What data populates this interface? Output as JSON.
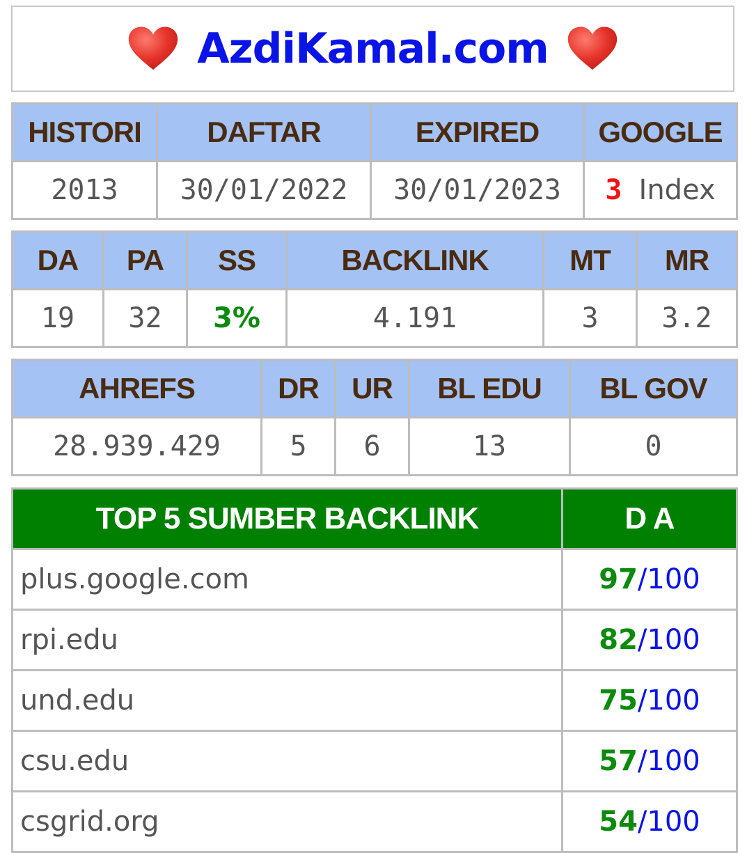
{
  "title": "AzdiKamal.com",
  "colors": {
    "title": "#0a14e6",
    "header_bg": "#a4c2f4",
    "header_text": "#4a2b10",
    "top_header_bg": "#008000",
    "score_green": "#0b8a0b",
    "google_count_red": "#f01414",
    "heart": "#e5332a"
  },
  "icons": {
    "left": "heart-icon",
    "right": "heart-icon"
  },
  "table1": {
    "headers": [
      "HISTORI",
      "DAFTAR",
      "EXPIRED",
      "GOOGLE"
    ],
    "values": {
      "histori": "2013",
      "daftar": "30/01/2022",
      "expired": "30/01/2023",
      "google_count": "3",
      "google_label": "Index"
    }
  },
  "table2": {
    "headers": [
      "DA",
      "PA",
      "SS",
      "BACKLINK",
      "MT",
      "MR"
    ],
    "values": [
      "19",
      "32",
      "3%",
      "4.191",
      "3",
      "3.2"
    ]
  },
  "table3": {
    "headers": [
      "AHREFS",
      "DR",
      "UR",
      "BL EDU",
      "BL GOV"
    ],
    "values": [
      "28.939.429",
      "5",
      "6",
      "13",
      "0"
    ]
  },
  "top_backlinks": {
    "header_source": "TOP 5 SUMBER BACKLINK",
    "header_da": "D A",
    "rows": [
      {
        "domain": "plus.google.com",
        "da": "97",
        "max": "100"
      },
      {
        "domain": "rpi.edu",
        "da": "82",
        "max": "100"
      },
      {
        "domain": "und.edu",
        "da": "75",
        "max": "100"
      },
      {
        "domain": "csu.edu",
        "da": "57",
        "max": "100"
      },
      {
        "domain": "csgrid.org",
        "da": "54",
        "max": "100"
      }
    ]
  }
}
